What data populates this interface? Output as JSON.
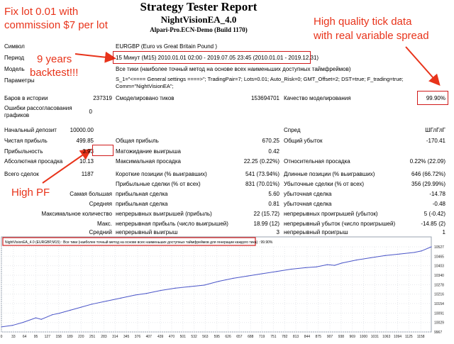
{
  "header": {
    "title": "Strategy Tester Report",
    "ea_name": "NightVisionEA_4.0",
    "account": "Alpari-Pro.ECN-Demo (Build 1170)"
  },
  "annotations": {
    "lot_line1": "Fix lot 0.01 with",
    "lot_line2": "commission $7 per lot",
    "years_line1": "9 years",
    "years_line2": "backtest!!!",
    "tick_line1": "High quality tick data",
    "tick_line2": "with real variable spread",
    "high_pf": "High PF",
    "accent_color": "#e8331a"
  },
  "settings": {
    "symbol_label": "Символ",
    "symbol_value": "EURGBP (Euro vs Great Britain Pound )",
    "period_label": "Период",
    "period_value": "15 Минут (M15) 2010.01.01 02:00 - 2019.07.05 23:45 (2010.01.01 - 2019.12.31)",
    "model_label": "Модель",
    "model_value": "Все тики (наиболее точный метод на основе всех наименьших доступных таймфреймов)",
    "params_label": "Параметры",
    "params_line1": "S_1=\"<==== General settings ====>\"; TradingPair=7; Lots=0.01; Auto_Risk=0; GMT_Offset=2; DST=true; F_trading=true;",
    "params_line2": "Comm=\"NightVisionEA\";"
  },
  "stats": {
    "bars_label": "Баров в истории",
    "bars_value": "237319",
    "ticks_label": "Смоделировано тиков",
    "ticks_value": "153694701",
    "quality_label": "Качество моделирования",
    "quality_value": "99.90%",
    "errors_label_1": "Ошибки рассогласования",
    "errors_label_2": "графиков",
    "errors_value": "0",
    "deposit_label": "Начальный депозит",
    "deposit_value": "10000.00",
    "spread_label": "Спред",
    "spread_value": "ШГлГлГ",
    "netprofit_label": "Чистая прибыль",
    "netprofit_value": "499.85",
    "grossprofit_label": "Общая прибыль",
    "grossprofit_value": "670.25",
    "grossloss_label": "Общий убыток",
    "grossloss_value": "-170.41",
    "pf_label": "Прибыльность",
    "pf_value": "3.93",
    "payoff_label": "Матожидание выигрыша",
    "payoff_value": "0.42",
    "absdd_label": "Абсолютная просадка",
    "absdd_value": "10.13",
    "maxdd_label": "Максимальная просадка",
    "maxdd_value": "22.25 (0.22%)",
    "reldd_label": "Относительная просадка",
    "reldd_value": "0.22% (22.09)",
    "trades_label": "Всего сделок",
    "trades_value": "1187",
    "short_label": "Короткие позиции (% выигравших)",
    "short_value": "541 (73.94%)",
    "long_label": "Длинные позиции (% выигравших)",
    "long_value": "646 (66.72%)",
    "proftrades_label": "Прибыльные сделки (% от всех)",
    "proftrades_value": "831 (70.01%)",
    "losstrades_label": "Убыточные сделки (% от всех)",
    "losstrades_value": "356 (29.99%)",
    "largest_label": "Самая большая",
    "largest_prof_label": "прибыльная сделка",
    "largest_prof_value": "5.60",
    "largest_loss_label": "убыточная сделка",
    "largest_loss_value": "-14.78",
    "average_label": "Средняя",
    "average_prof_label": "прибыльная сделка",
    "average_prof_value": "0.81",
    "average_loss_label": "убыточная сделка",
    "average_loss_value": "-0.48",
    "maxcount_label": "Максимальное количество",
    "maxcount_wins_label": "непрерывных выигрышей (прибыль)",
    "maxcount_wins_value": "22 (15.72)",
    "maxcount_loss_label": "непрерывных проигрышей (убыток)",
    "maxcount_loss_value": "5 (-0.42)",
    "maxi_label": "Макс.",
    "maxi_prof_label": "непрерывная прибыль (число выигрышей)",
    "maxi_prof_value": "18.99 (12)",
    "maxi_loss_label": "непрерывный убыток (число проигрышей)",
    "maxi_loss_value": "-14.85 (2)",
    "avgcons_label": "Средний",
    "avgcons_win_label": "непрерывный выигрыш",
    "avgcons_win_value": "3",
    "avgcons_loss_label": "непрерывный проигрыш",
    "avgcons_loss_value": "1"
  },
  "chart_data": {
    "type": "line",
    "title": "NightVisionEA_4.0 (EURGBP,M15) : Все тики (наиболее точный метод на основе всех наименьших доступных таймфреймов для генерации каждого тика) : 99.90%",
    "xlabel": "",
    "ylabel": "",
    "x_ticks": [
      "0",
      "33",
      "64",
      "95",
      "127",
      "158",
      "189",
      "220",
      "251",
      "283",
      "314",
      "345",
      "376",
      "407",
      "439",
      "470",
      "501",
      "532",
      "563",
      "595",
      "626",
      "657",
      "688",
      "719",
      "751",
      "782",
      "813",
      "844",
      "875",
      "907",
      "938",
      "969",
      "1000",
      "1031",
      "1063",
      "1094",
      "1125",
      "1158"
    ],
    "y_ticks": [
      "10527",
      "10465",
      "10403",
      "10340",
      "10278",
      "10216",
      "10154",
      "10091",
      "10029",
      "9967"
    ],
    "ylim": [
      9967,
      10527
    ],
    "xlim": [
      0,
      1187
    ],
    "series": [
      {
        "x": [
          0,
          30,
          60,
          95,
          110,
          140,
          160,
          190,
          220,
          250,
          290,
          330,
          370,
          400,
          440,
          480,
          520,
          560,
          600,
          620,
          640,
          680,
          720,
          760,
          800,
          840,
          870,
          900,
          920,
          940,
          980,
          1020,
          1060,
          1100,
          1140,
          1160,
          1187
        ],
        "values": [
          10000,
          10010,
          10030,
          10060,
          10050,
          10080,
          10090,
          10110,
          10130,
          10150,
          10170,
          10190,
          10210,
          10220,
          10240,
          10255,
          10265,
          10275,
          10300,
          10310,
          10320,
          10335,
          10350,
          10365,
          10380,
          10390,
          10395,
          10410,
          10405,
          10420,
          10440,
          10455,
          10470,
          10480,
          10490,
          10500,
          10527
        ]
      }
    ],
    "line_color": "#4a55c8",
    "grid": true
  }
}
